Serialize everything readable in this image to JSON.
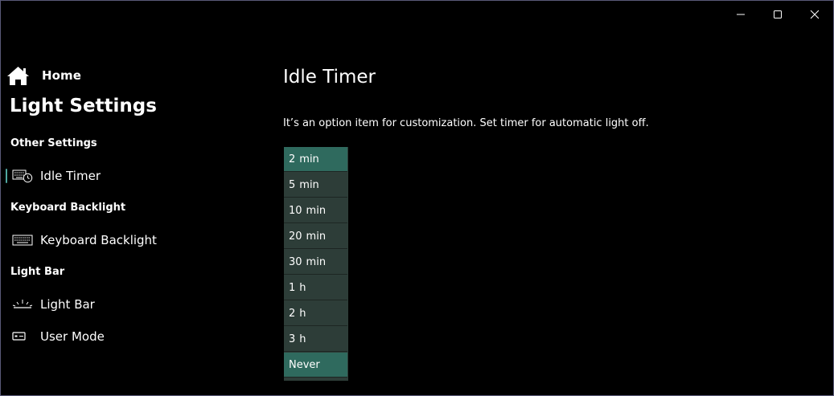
{
  "window": {
    "caption_buttons": {
      "minimize_icon": "minimize-icon",
      "maximize_icon": "maximize-icon",
      "close_icon": "close-icon"
    }
  },
  "sidebar": {
    "home_label": "Home",
    "app_title": "Light Settings",
    "sections": [
      {
        "header": "Other Settings",
        "items": [
          {
            "label": "Idle Timer",
            "icon": "idle-timer-icon",
            "selected": true
          }
        ]
      },
      {
        "header": "Keyboard Backlight",
        "items": [
          {
            "label": "Keyboard Backlight",
            "icon": "keyboard-icon",
            "selected": false
          }
        ]
      },
      {
        "header": "Light Bar",
        "items": [
          {
            "label": "Light Bar",
            "icon": "light-bar-icon",
            "selected": false
          },
          {
            "label": "User Mode",
            "icon": "user-mode-icon",
            "selected": false
          }
        ]
      }
    ]
  },
  "main": {
    "title": "Idle Timer",
    "description": "It’s an option item for customization. Set timer for automatic light off.",
    "options": [
      {
        "value": "2",
        "unit": "min",
        "selected": true
      },
      {
        "value": "5",
        "unit": "min",
        "selected": false
      },
      {
        "value": "10",
        "unit": "min",
        "selected": false
      },
      {
        "value": "20",
        "unit": "min",
        "selected": false
      },
      {
        "value": "30",
        "unit": "min",
        "selected": false
      },
      {
        "value": "1",
        "unit": "h",
        "selected": false
      },
      {
        "value": "2",
        "unit": "h",
        "selected": false
      },
      {
        "value": "3",
        "unit": "h",
        "selected": false
      },
      {
        "value": "Never",
        "unit": "",
        "selected": false,
        "hovered": true
      }
    ]
  },
  "colors": {
    "background": "#000000",
    "accent": "#2f6a5e",
    "option_bg": "#2d3d38",
    "selection_indicator": "#4fa7a0"
  }
}
